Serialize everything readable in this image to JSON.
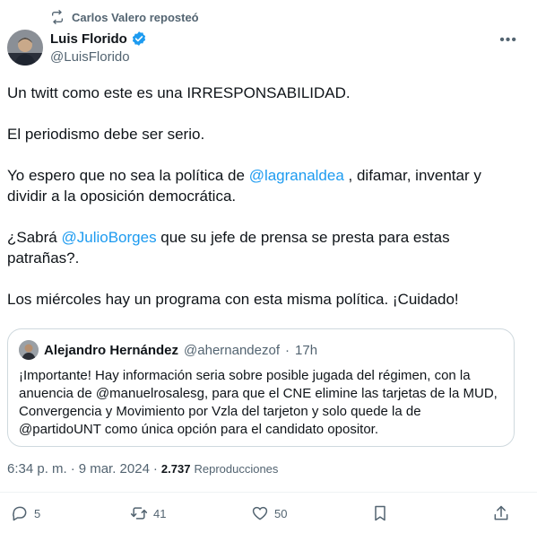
{
  "repost": {
    "icon": "repost-icon",
    "text": "Carlos Valero reposteó"
  },
  "author": {
    "name": "Luis Florido",
    "handle": "@LuisFlorido",
    "verified_color": "#1d9bf0"
  },
  "tweet": {
    "line1": "Un twitt como este es una IRRESPONSABILIDAD.",
    "line2": "El periodismo debe ser serio.",
    "line3_pre": "Yo espero que no sea la política de ",
    "line3_mention": "@lagranaldea",
    "line3_post": " , difamar, inventar y dividir a la oposición democrática.",
    "line4_pre": "¿Sabrá ",
    "line4_mention": "@JulioBorges",
    "line4_post": " que su jefe de prensa se presta para estas patrañas?.",
    "line5": "Los miércoles hay un programa con esta misma política. ¡Cuidado!"
  },
  "quote": {
    "name": "Alejandro Hernández",
    "handle": "@ahernandezof",
    "dot": "·",
    "time": "17h",
    "text": "¡Importante! Hay información seria sobre posible jugada del régimen, con la anuencia de @manuelrosalesg, para que el CNE elimine las tarjetas de la MUD, Convergencia y Movimiento por Vzla del tarjeton y solo quede la de @partidoUNT como única opción para el candidato opositor."
  },
  "meta": {
    "time": "6:34 p. m.",
    "sep1": "·",
    "date": "9 mar. 2024",
    "sep2": "·",
    "views_count": "2.737",
    "views_label": "Reproducciones"
  },
  "actions": {
    "replies": "5",
    "reposts": "41",
    "likes": "50"
  },
  "colors": {
    "accent": "#1d9bf0",
    "text": "#0f1419",
    "muted": "#536471",
    "border": "#cfd9de"
  }
}
